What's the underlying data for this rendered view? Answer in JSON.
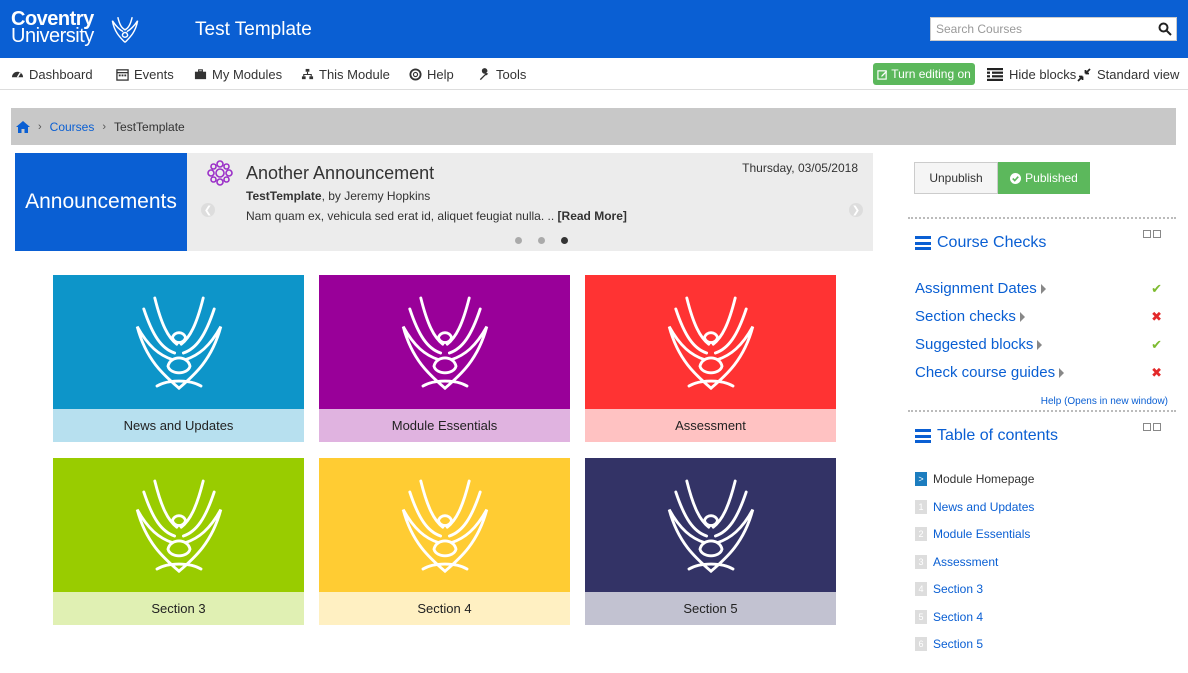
{
  "header": {
    "logo_line1": "Coventry",
    "logo_line2": "University",
    "site_title": "Test Template",
    "search_placeholder": "Search Courses",
    "brand_color": "#0a5fd3"
  },
  "nav": {
    "items": [
      {
        "label": "Dashboard",
        "icon": "dashboard-icon"
      },
      {
        "label": "Events",
        "icon": "calendar-icon"
      },
      {
        "label": "My Modules",
        "icon": "briefcase-icon"
      },
      {
        "label": "This Module",
        "icon": "sitemap-icon"
      },
      {
        "label": "Help",
        "icon": "lifebuoy-icon"
      },
      {
        "label": "Tools",
        "icon": "wrench-icon"
      }
    ],
    "edit_label": "Turn editing on",
    "hide_blocks_label": "Hide blocks",
    "standard_view_label": "Standard view"
  },
  "breadcrumb": {
    "home_icon": "home-icon",
    "courses": "Courses",
    "current": "TestTemplate"
  },
  "announcement": {
    "label": "Announcements",
    "title": "Another Announcement",
    "date": "Thursday, 03/05/2018",
    "author_course": "TestTemplate",
    "author_by": ", by Jeremy Hopkins",
    "body": "Nam quam ex, vehicula sed erat id, aliquet feugiat nulla. ..",
    "read_more": "[Read More]",
    "active_slide": 3,
    "slide_count": 3
  },
  "tiles": [
    {
      "label": "News and Updates",
      "top_color": "#0d95c9",
      "bottom_color": "#b7e0ef",
      "bird_color": "#ffffff"
    },
    {
      "label": "Module Essentials",
      "top_color": "#990099",
      "bottom_color": "#e0b3e0",
      "bird_color": "#ffffff"
    },
    {
      "label": "Assessment",
      "top_color": "#ff3333",
      "bottom_color": "#ffc2c2",
      "bird_color": "#ffffff"
    },
    {
      "label": "Section 3",
      "top_color": "#99cc00",
      "bottom_color": "#e0f0b3",
      "bird_color": "#ffffff"
    },
    {
      "label": "Section 4",
      "top_color": "#ffcc33",
      "bottom_color": "#fff0c2",
      "bird_color": "#ffffff"
    },
    {
      "label": "Section 5",
      "top_color": "#333366",
      "bottom_color": "#c2c2d1",
      "bird_color": "#ffffff"
    }
  ],
  "publish": {
    "unpublish_label": "Unpublish",
    "published_label": "Published"
  },
  "course_checks": {
    "title": "Course Checks",
    "items": [
      {
        "label": "Assignment Dates",
        "status": "ok"
      },
      {
        "label": "Section checks",
        "status": "bad"
      },
      {
        "label": "Suggested blocks",
        "status": "ok"
      },
      {
        "label": "Check course guides",
        "status": "bad"
      }
    ],
    "help_link": "Help (Opens in new window)"
  },
  "toc": {
    "title": "Table of contents",
    "items": [
      {
        "num": ">",
        "label": "Module Homepage",
        "current": true
      },
      {
        "num": "1",
        "label": "News and Updates",
        "current": false
      },
      {
        "num": "2",
        "label": "Module Essentials",
        "current": false
      },
      {
        "num": "3",
        "label": "Assessment",
        "current": false
      },
      {
        "num": "4",
        "label": "Section 3",
        "current": false
      },
      {
        "num": "5",
        "label": "Section 4",
        "current": false
      },
      {
        "num": "6",
        "label": "Section 5",
        "current": false
      }
    ]
  }
}
